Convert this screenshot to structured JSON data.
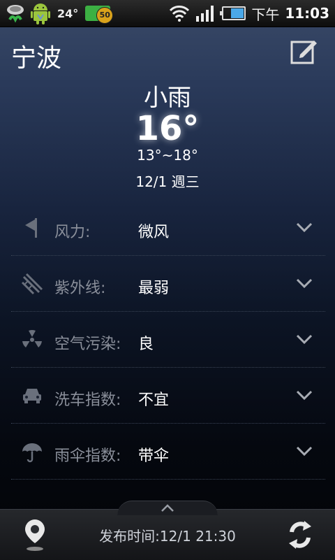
{
  "statusbar": {
    "temperature": "24°",
    "notification_count": "50",
    "time_period": "下午",
    "time": "11:03"
  },
  "header": {
    "city": "宁波"
  },
  "weather": {
    "condition": "小雨",
    "temperature": "16°",
    "range": "13°~18°",
    "date": "12/1 週三"
  },
  "details": [
    {
      "icon": "wind-flag-icon",
      "label": "风力:",
      "value": "微风"
    },
    {
      "icon": "uv-rays-icon",
      "label": "紫外线:",
      "value": "最弱"
    },
    {
      "icon": "pollution-hazard-icon",
      "label": "空气污染:",
      "value": "良"
    },
    {
      "icon": "car-icon",
      "label": "洗车指数:",
      "value": "不宜"
    },
    {
      "icon": "umbrella-icon",
      "label": "雨伞指数:",
      "value": "带伞"
    }
  ],
  "footer": {
    "publish_label": "发布时间:",
    "publish_time": "12/1 21:30"
  }
}
